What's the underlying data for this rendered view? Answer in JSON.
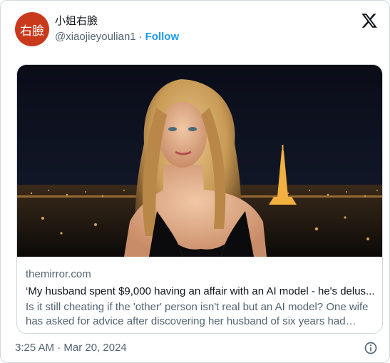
{
  "author": {
    "avatar_text": "右臉",
    "display_name": "小姐右臉",
    "handle": "@xiaojieyoulian1",
    "separator": "·",
    "follow_label": "Follow"
  },
  "card": {
    "domain": "themirror.com",
    "title": "‘My husband spent $9,000 having an affair with an AI model - he's delus...",
    "description": "Is it still cheating if the 'other' person isn't real but an AI model? One wife has asked for advice after discovering her husband of six years had spen..."
  },
  "footer": {
    "timestamp": "3:25 AM · Mar 20, 2024"
  },
  "icons": {
    "brand": "x-logo-icon",
    "info": "info-icon"
  },
  "colors": {
    "accent": "#1d9bf0",
    "avatar_bg": "#c93a1c",
    "secondary_text": "#536471",
    "border": "#cfd9de"
  }
}
